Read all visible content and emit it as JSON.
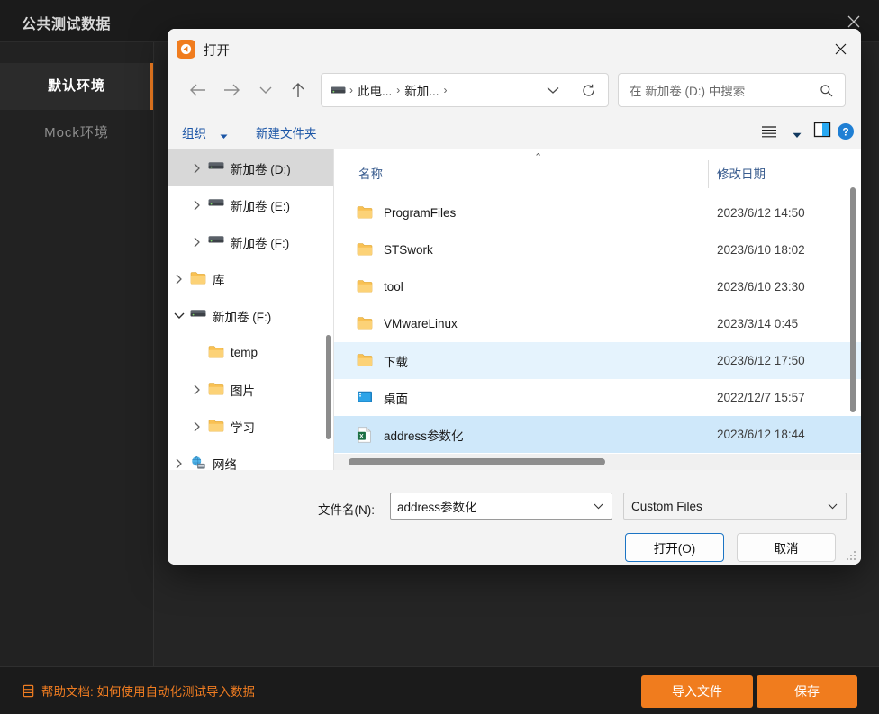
{
  "app": {
    "title": "公共测试数据",
    "close_icon": "close-icon",
    "sidebar": {
      "items": [
        {
          "label": "默认环境",
          "active": true
        },
        {
          "label": "Mock环境",
          "active": false
        }
      ]
    },
    "bottom_bar": {
      "help_icon": "book-icon",
      "help_text": "帮助文档: 如何使用自动化测试导入数据",
      "import_label": "导入文件",
      "save_label": "保存"
    },
    "colors": {
      "accent": "#f07c1e",
      "background": "#222222",
      "titlebar": "#1b1b1b",
      "sidebar_active": "#2b2b2b"
    }
  },
  "dialog": {
    "title": "打开",
    "app_icon": "open-app-icon",
    "close_icon": "close-icon",
    "nav": {
      "back_icon": "arrow-left-icon",
      "forward_icon": "arrow-right-icon",
      "recent_icon": "chevron-down-icon",
      "up_icon": "arrow-up-icon",
      "refresh_icon": "refresh-icon",
      "dropdown_icon": "chevron-down-icon"
    },
    "address": {
      "drive_icon": "drive-icon",
      "crumbs": [
        "此电...",
        "新加..."
      ],
      "separator": "›"
    },
    "search": {
      "placeholder": "在 新加卷 (D:) 中搜索",
      "icon": "search-icon"
    },
    "commandbar": {
      "organize_label": "组织",
      "organize_caret_icon": "caret-down-icon",
      "newfolder_label": "新建文件夹",
      "view_menu_icon": "list-view-icon",
      "view_caret_icon": "caret-down-icon",
      "preview_pane_icon": "preview-pane-icon",
      "help_icon": "help-circle-icon"
    },
    "tree": [
      {
        "label": "新加卷 (D:)",
        "icon": "drive-icon",
        "indent": 1,
        "chevron": "right",
        "selected": true
      },
      {
        "label": "新加卷 (E:)",
        "icon": "drive-icon",
        "indent": 1,
        "chevron": "right",
        "selected": false
      },
      {
        "label": "新加卷 (F:)",
        "icon": "drive-icon",
        "indent": 1,
        "chevron": "right",
        "selected": false
      },
      {
        "label": "库",
        "icon": "folder-icon",
        "indent": 0,
        "chevron": "right",
        "selected": false
      },
      {
        "label": "新加卷 (F:)",
        "icon": "drive-icon",
        "indent": 0,
        "chevron": "down",
        "selected": false
      },
      {
        "label": "temp",
        "icon": "folder-icon",
        "indent": 1,
        "chevron": "none",
        "selected": false
      },
      {
        "label": "图片",
        "icon": "folder-icon",
        "indent": 1,
        "chevron": "right",
        "selected": false
      },
      {
        "label": "学习",
        "icon": "folder-icon",
        "indent": 1,
        "chevron": "right",
        "selected": false
      },
      {
        "label": "网络",
        "icon": "network-icon",
        "indent": 0,
        "chevron": "right",
        "selected": false
      }
    ],
    "list": {
      "sort_indicator": "⌃",
      "columns": {
        "name": "名称",
        "date": "修改日期"
      },
      "rows": [
        {
          "name": "ProgramFiles",
          "date": "2023/6/12 14:50",
          "icon": "folder-icon",
          "state": "none"
        },
        {
          "name": "STSwork",
          "date": "2023/6/10 18:02",
          "icon": "folder-icon",
          "state": "none"
        },
        {
          "name": "tool",
          "date": "2023/6/10 23:30",
          "icon": "folder-icon",
          "state": "none"
        },
        {
          "name": "VMwareLinux",
          "date": "2023/3/14 0:45",
          "icon": "folder-icon",
          "state": "none"
        },
        {
          "name": "下载",
          "date": "2023/6/12 17:50",
          "icon": "folder-icon",
          "state": "highlight"
        },
        {
          "name": "桌面",
          "date": "2022/12/7 15:57",
          "icon": "desktop-icon",
          "state": "none"
        },
        {
          "name": "address参数化",
          "date": "2023/6/12 18:44",
          "icon": "excel-icon",
          "state": "selected"
        }
      ]
    },
    "footer": {
      "filename_label": "文件名(N):",
      "filename_value": "address参数化",
      "filename_caret_icon": "chevron-down-icon",
      "filter_value": "Custom Files",
      "filter_caret_icon": "chevron-down-icon",
      "open_label": "打开(O)",
      "cancel_label": "取消",
      "resize_grip": "resize-grip-icon"
    }
  }
}
